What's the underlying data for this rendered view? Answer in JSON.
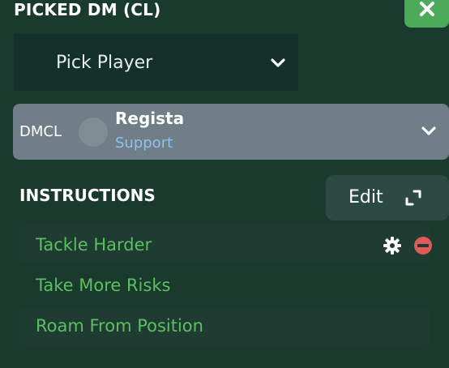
{
  "header": {
    "title": "PICKED DM (CL)"
  },
  "close_button": {
    "icon": "close-icon"
  },
  "player_select": {
    "label": "Pick Player",
    "icon": "chevron-down-icon"
  },
  "role": {
    "position": "DMCL",
    "name": "Regista",
    "duty": "Support",
    "icon": "chevron-down-icon"
  },
  "instructions": {
    "title": "INSTRUCTIONS",
    "edit_label": "Edit",
    "edit_icon": "expand-icon",
    "items": [
      {
        "label": "Tackle Harder"
      },
      {
        "label": "Take More Risks"
      },
      {
        "label": "Roam From Position"
      }
    ]
  },
  "colors": {
    "background": "#1a3a2e",
    "accent_green": "#4caa5a",
    "instruction_text": "#5cbf5f",
    "duty_text": "#8fc1ee",
    "remove_red": "#e05a5a"
  }
}
